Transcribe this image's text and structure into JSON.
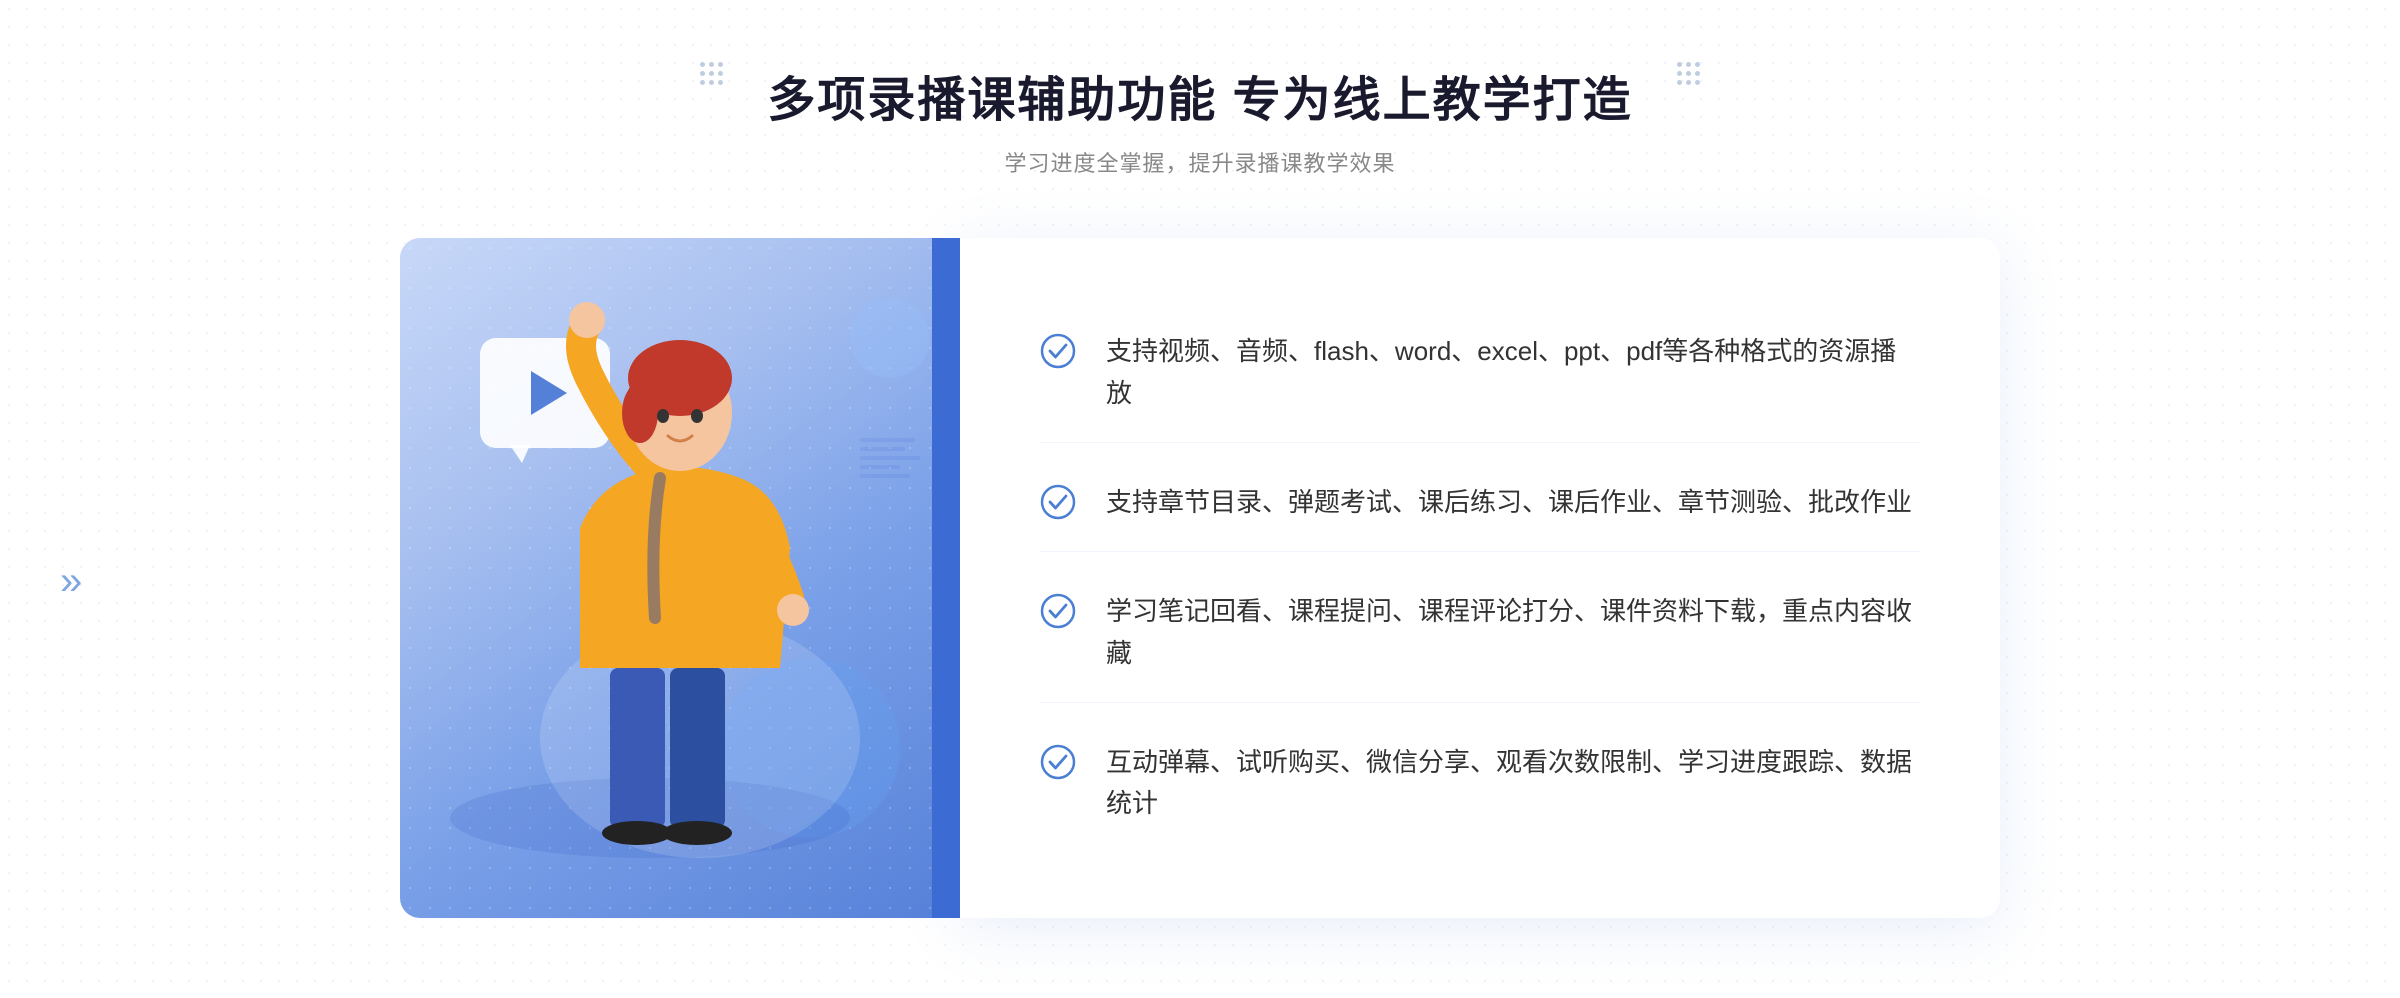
{
  "header": {
    "title": "多项录播课辅助功能 专为线上教学打造",
    "subtitle": "学习进度全掌握，提升录播课教学效果"
  },
  "features": [
    {
      "id": "feature-1",
      "text": "支持视频、音频、flash、word、excel、ppt、pdf等各种格式的资源播放"
    },
    {
      "id": "feature-2",
      "text": "支持章节目录、弹题考试、课后练习、课后作业、章节测验、批改作业"
    },
    {
      "id": "feature-3",
      "text": "学习笔记回看、课程提问、课程评论打分、课件资料下载，重点内容收藏"
    },
    {
      "id": "feature-4",
      "text": "互动弹幕、试听购买、微信分享、观看次数限制、学习进度跟踪、数据统计"
    }
  ],
  "icons": {
    "check": "check-circle-icon",
    "play": "play-icon",
    "chevron": "chevron-right-icon"
  },
  "colors": {
    "primary": "#4a7fd4",
    "title": "#1a1a2e",
    "subtitle": "#888888",
    "text": "#333333",
    "accent": "#3d6bd4",
    "panel_bg": "#ffffff"
  }
}
